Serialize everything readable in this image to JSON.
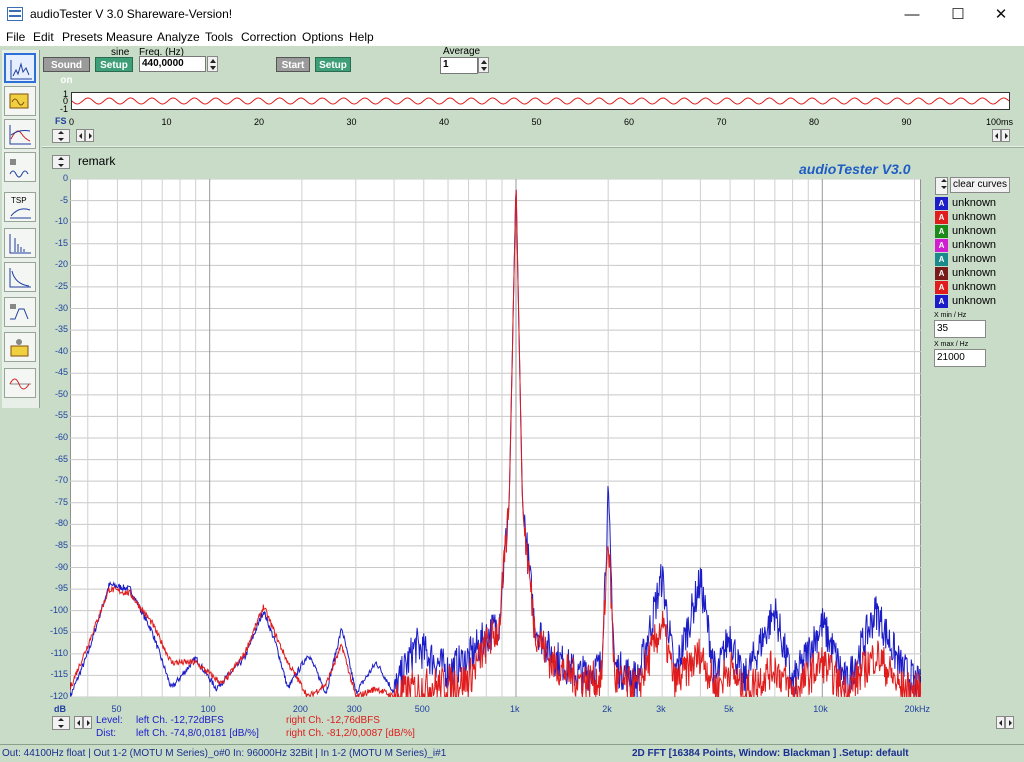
{
  "window": {
    "title": "audioTester  V 3.0 Shareware-Version!",
    "minimize_glyph": "—",
    "maximize_glyph": "☐",
    "close_glyph": "✕"
  },
  "menu": [
    "File",
    "Edit",
    "Presets",
    "Measure",
    "Analyze",
    "Tools",
    "Correction",
    "Options",
    "Help"
  ],
  "toolbar": {
    "sound_on_label": "Sound on",
    "generator_setup_label": "Setup",
    "waveform_label": "sine",
    "freq_label": "Freq. (Hz)",
    "freq_value": "440,0000",
    "start_label": "Start",
    "analyzer_setup_label": "Setup",
    "average_label": "Average",
    "average_value": "1"
  },
  "tool_icons": [
    "fft-spectrum-icon",
    "oscilloscope-icon",
    "frequency-response-icon",
    "distortion-icon",
    "tsp-icon",
    "impulse-icon",
    "decay-icon",
    "filter-icon",
    "speaker-icon",
    "waveform-icon"
  ],
  "tsp_label": "TSP",
  "scope": {
    "y_labels": [
      "1",
      "0",
      "-1"
    ],
    "fs_label": "FS",
    "x_ticks": [
      "0",
      "10",
      "20",
      "30",
      "40",
      "50",
      "60",
      "70",
      "80",
      "90",
      "100ms"
    ]
  },
  "remark": "remark",
  "brand": "audioTester  V3.0",
  "chart_data": {
    "type": "line",
    "y_unit_label": "dB",
    "y_ticks": [
      "0",
      "-5",
      "-10",
      "-15",
      "-20",
      "-25",
      "-30",
      "-35",
      "-40",
      "-45",
      "-50",
      "-55",
      "-60",
      "-65",
      "-70",
      "-75",
      "-80",
      "-85",
      "-90",
      "-95",
      "-100",
      "-105",
      "-110",
      "-115",
      "-120"
    ],
    "ylim": [
      -120,
      0
    ],
    "x_scale": "log",
    "xlim": [
      35,
      21000
    ],
    "x_ticks": [
      {
        "v": 50,
        "label": "50"
      },
      {
        "v": 100,
        "label": "100"
      },
      {
        "v": 200,
        "label": "200"
      },
      {
        "v": 300,
        "label": "300"
      },
      {
        "v": 500,
        "label": "500"
      },
      {
        "v": 1000,
        "label": "1k"
      },
      {
        "v": 2000,
        "label": "2k"
      },
      {
        "v": 3000,
        "label": "3k"
      },
      {
        "v": 5000,
        "label": "5k"
      },
      {
        "v": 10000,
        "label": "10k"
      },
      {
        "v": 20000,
        "label": "20kHz"
      }
    ],
    "grid": true,
    "series": [
      {
        "color": "#1c1cc8",
        "points": [
          [
            35,
            -120
          ],
          [
            40,
            -110
          ],
          [
            47,
            -94
          ],
          [
            55,
            -95
          ],
          [
            65,
            -105
          ],
          [
            75,
            -118
          ],
          [
            90,
            -111
          ],
          [
            105,
            -118
          ],
          [
            130,
            -111
          ],
          [
            150,
            -100
          ],
          [
            165,
            -108
          ],
          [
            180,
            -118
          ],
          [
            210,
            -110
          ],
          [
            240,
            -119
          ],
          [
            270,
            -104
          ],
          [
            300,
            -119
          ],
          [
            350,
            -112
          ],
          [
            400,
            -119
          ],
          [
            470,
            -108
          ],
          [
            600,
            -114
          ],
          [
            700,
            -111
          ],
          [
            800,
            -106
          ],
          [
            880,
            -103
          ],
          [
            950,
            -75
          ],
          [
            1000,
            -1
          ],
          [
            1050,
            -75
          ],
          [
            1150,
            -103
          ],
          [
            1300,
            -110
          ],
          [
            1600,
            -115
          ],
          [
            1900,
            -113
          ],
          [
            2000,
            -74
          ],
          [
            2100,
            -113
          ],
          [
            2500,
            -116
          ],
          [
            3000,
            -92
          ],
          [
            3300,
            -115
          ],
          [
            4000,
            -93
          ],
          [
            4500,
            -116
          ],
          [
            5000,
            -105
          ],
          [
            5500,
            -117
          ],
          [
            7000,
            -100
          ],
          [
            8000,
            -117
          ],
          [
            10000,
            -103
          ],
          [
            12000,
            -117
          ],
          [
            15000,
            -100
          ],
          [
            18000,
            -113
          ],
          [
            21000,
            -118
          ]
        ]
      },
      {
        "color": "#e01c1c",
        "points": [
          [
            35,
            -118
          ],
          [
            40,
            -108
          ],
          [
            47,
            -95
          ],
          [
            55,
            -96
          ],
          [
            65,
            -103
          ],
          [
            75,
            -112
          ],
          [
            90,
            -112
          ],
          [
            110,
            -117
          ],
          [
            130,
            -110
          ],
          [
            150,
            -99
          ],
          [
            165,
            -106
          ],
          [
            180,
            -112
          ],
          [
            210,
            -120
          ],
          [
            240,
            -117
          ],
          [
            270,
            -108
          ],
          [
            300,
            -120
          ],
          [
            350,
            -118
          ],
          [
            400,
            -120
          ],
          [
            470,
            -118
          ],
          [
            600,
            -117
          ],
          [
            700,
            -116
          ],
          [
            800,
            -108
          ],
          [
            880,
            -104
          ],
          [
            950,
            -76
          ],
          [
            1000,
            0
          ],
          [
            1050,
            -76
          ],
          [
            1150,
            -104
          ],
          [
            1300,
            -112
          ],
          [
            1600,
            -116
          ],
          [
            1900,
            -116
          ],
          [
            2000,
            -82
          ],
          [
            2100,
            -116
          ],
          [
            2500,
            -118
          ],
          [
            3000,
            -103
          ],
          [
            3300,
            -117
          ],
          [
            4000,
            -110
          ],
          [
            4500,
            -118
          ],
          [
            5000,
            -113
          ],
          [
            5500,
            -119
          ],
          [
            7000,
            -113
          ],
          [
            8000,
            -119
          ],
          [
            10000,
            -112
          ],
          [
            12000,
            -119
          ],
          [
            15000,
            -110
          ],
          [
            18000,
            -118
          ],
          [
            21000,
            -119
          ]
        ]
      }
    ]
  },
  "curves_panel": {
    "clear_label": "clear curves",
    "items": [
      {
        "glyph": "A",
        "color": "#1c1cc8",
        "name": "unknown"
      },
      {
        "glyph": "A",
        "color": "#e01c1c",
        "name": "unknown"
      },
      {
        "glyph": "A",
        "color": "#1b8a1b",
        "name": "unknown"
      },
      {
        "glyph": "A",
        "color": "#d01ed0",
        "name": "unknown"
      },
      {
        "glyph": "A",
        "color": "#1b8a8a",
        "name": "unknown"
      },
      {
        "glyph": "A",
        "color": "#7a1b1b",
        "name": "unknown"
      },
      {
        "glyph": "A",
        "color": "#e01c1c",
        "name": "unknown"
      },
      {
        "glyph": "A",
        "color": "#1c1cc8",
        "name": "unknown"
      }
    ],
    "xmin_label": "X min / Hz",
    "xmin_value": "35",
    "xmax_label": "X max / Hz",
    "xmax_value": "21000"
  },
  "readout": {
    "level_label": "Level:",
    "dist_label": "Dist:",
    "left_level": "left Ch. -12,72dBFS",
    "left_dist": "left Ch. -74,8/0,0181 [dB/%]",
    "right_level": "right Ch. -12,76dBFS",
    "right_dist": "right Ch. -81,2/0,0087 [dB/%]"
  },
  "status": {
    "left": "Out: 44100Hz float  | Out 1-2 (MOTU M Series)_o#0  In: 96000Hz 32Bit  | In 1-2 (MOTU M Series)_i#1",
    "right": "2D FFT [16384 Points, Window: Blackman ]  .Setup:  default"
  },
  "colors": {
    "background": "#c8dcc8",
    "left_channel": "#1c1cc8",
    "right_channel": "#e01c1c",
    "accent_green": "#3e9e78"
  }
}
